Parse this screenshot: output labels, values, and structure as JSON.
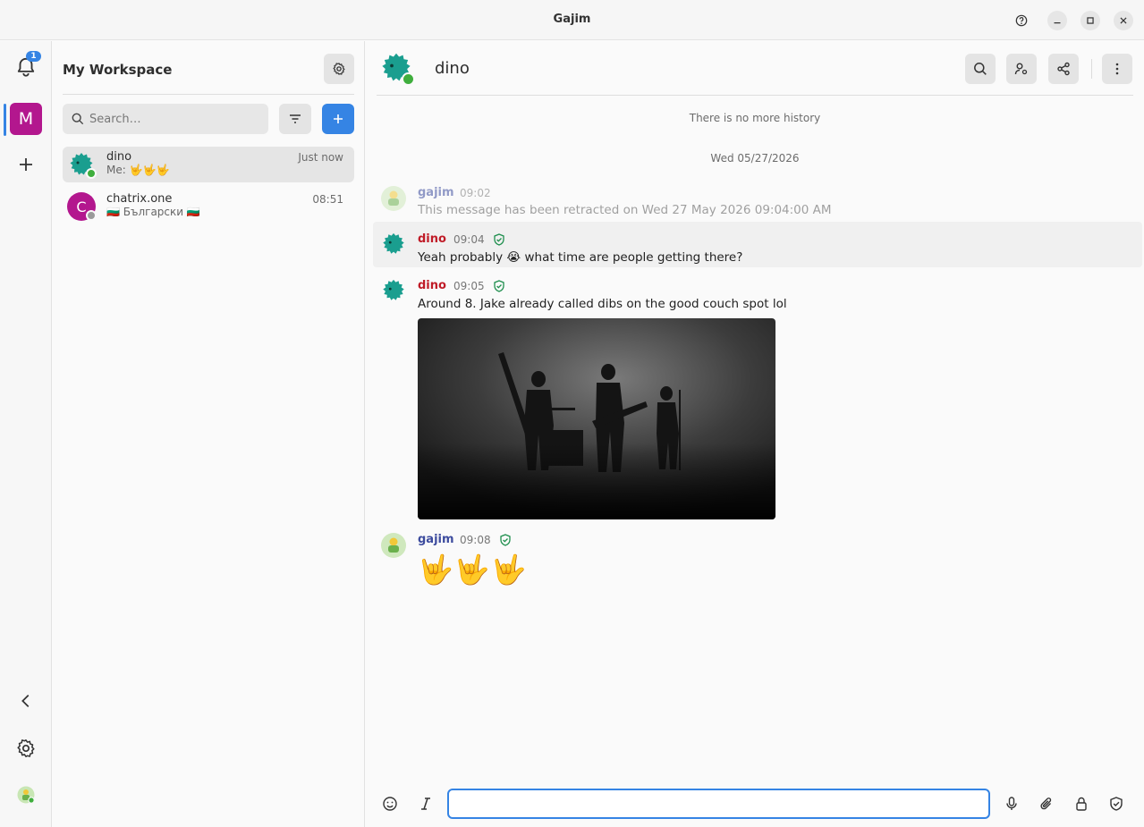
{
  "window": {
    "title": "Gajim"
  },
  "rail": {
    "notification_count": "1",
    "workspace_letter": "M"
  },
  "chatlist": {
    "workspace_title": "My Workspace",
    "search_placeholder": "Search…",
    "chats": [
      {
        "name": "dino",
        "preview": "Me: 🤟🤟🤟",
        "time": "Just now",
        "status": "online"
      },
      {
        "name": "chatrix.one",
        "avatar_letter": "C",
        "preview": "🇧🇬 Български 🇧🇬",
        "time": "08:51",
        "status": "offline"
      }
    ]
  },
  "conversation": {
    "contact_name": "dino",
    "no_history": "There is no more history",
    "date_divider": "Wed 05/27/2026",
    "messages": [
      {
        "author": "gajim",
        "time": "09:02",
        "text": "This message has been retracted on Wed 27 May 2026 09:04:00 AM",
        "retracted": true
      },
      {
        "author": "dino",
        "time": "09:04",
        "text": "Yeah probably 😭 what time are people getting there?"
      },
      {
        "author": "dino",
        "time": "09:05",
        "text": "Around 8. Jake already called dibs on the good couch spot lol",
        "has_image": true
      },
      {
        "author": "gajim",
        "time": "09:08",
        "text": "🤟🤟🤟"
      }
    ]
  },
  "composer": {
    "value": ""
  },
  "colors": {
    "accent": "#3584e4",
    "dino_name": "#c01c28",
    "gajim_name": "#3d4c9e",
    "online": "#3fae3d",
    "workspace": "#b3178e",
    "verified": "#1f8f4e"
  }
}
